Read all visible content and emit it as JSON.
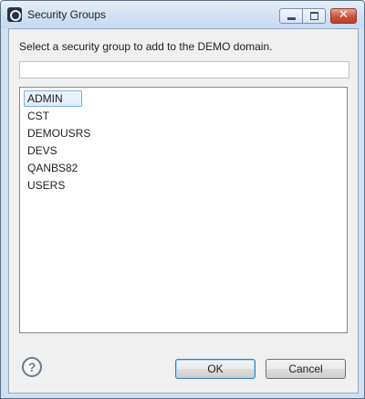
{
  "window": {
    "title": "Security Groups",
    "icon": "app-logo-icon",
    "controls": {
      "minimize": "minimize-icon",
      "maximize": "maximize-icon",
      "close": "✕"
    }
  },
  "dialog": {
    "instruction": "Select a security group to add to the DEMO domain.",
    "filter": {
      "value": "",
      "placeholder": ""
    },
    "groups": [
      {
        "label": "ADMIN",
        "selected": true
      },
      {
        "label": "CST",
        "selected": false
      },
      {
        "label": "DEMOUSRS",
        "selected": false
      },
      {
        "label": "DEVS",
        "selected": false
      },
      {
        "label": "QANBS82",
        "selected": false
      },
      {
        "label": "USERS",
        "selected": false
      }
    ]
  },
  "footer": {
    "help_glyph": "?",
    "ok_label": "OK",
    "cancel_label": "Cancel"
  }
}
